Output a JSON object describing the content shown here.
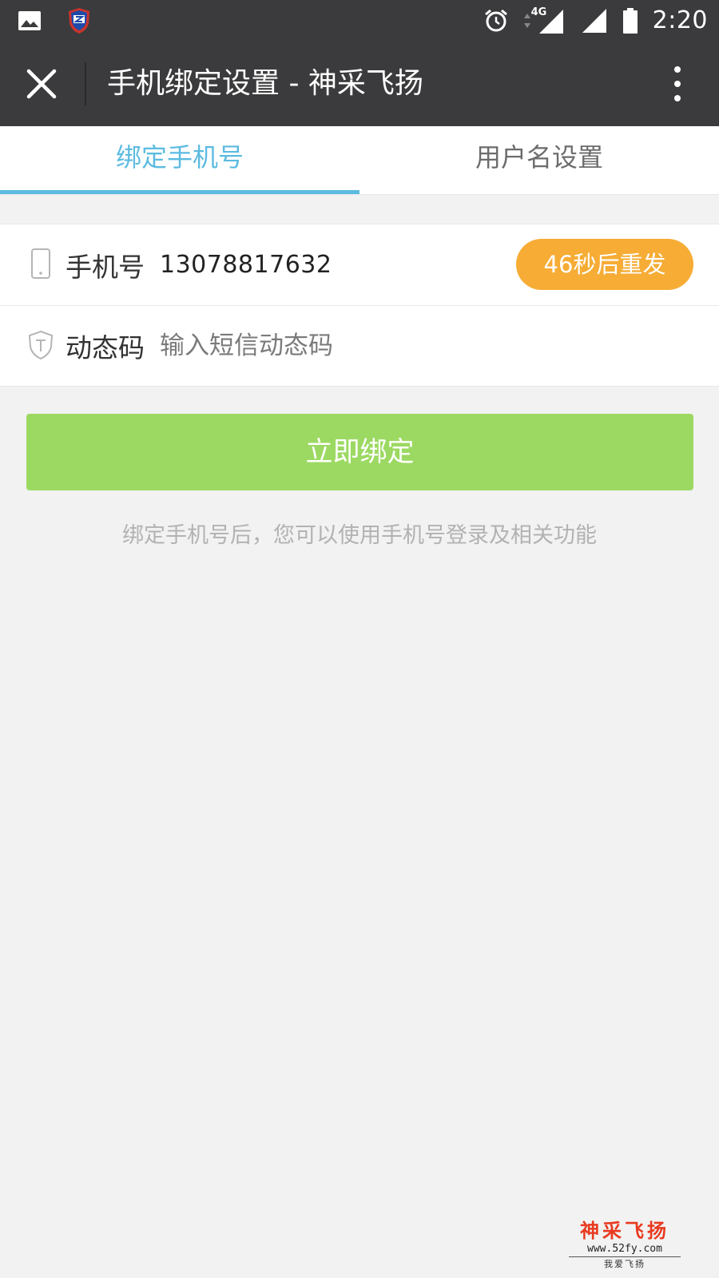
{
  "status_bar": {
    "time": "2:20",
    "network": "4G",
    "icons": [
      "image-notification-icon",
      "shield-app-icon",
      "alarm-icon",
      "data-arrows-icon",
      "signal-4g-icon",
      "signal-icon",
      "battery-icon"
    ]
  },
  "header": {
    "title": "手机绑定设置 - 神采飞扬",
    "icons": [
      "close-icon",
      "more-vertical-icon"
    ]
  },
  "tabs": [
    {
      "label": "绑定手机号",
      "active": true
    },
    {
      "label": "用户名设置",
      "active": false
    }
  ],
  "form": {
    "phone": {
      "label": "手机号",
      "value": "13078817632",
      "icon": "phone-icon",
      "resend_label": "46秒后重发"
    },
    "code": {
      "label": "动态码",
      "placeholder": "输入短信动态码",
      "value": "",
      "icon": "shield-t-icon"
    }
  },
  "bind_button": {
    "label": "立即绑定"
  },
  "hint": "绑定手机号后，您可以使用手机号登录及相关功能",
  "watermark": {
    "title": "神采飞扬",
    "url": "www.52fy.com",
    "slogan": "我爱飞扬"
  },
  "colors": {
    "status_bar_bg": "#3b3b3d",
    "tab_active": "#5cbbe0",
    "resend_bg": "#f6ac35",
    "bind_bg": "#9cd962",
    "page_bg": "#f2f2f2",
    "watermark_red": "#e83a1f"
  }
}
